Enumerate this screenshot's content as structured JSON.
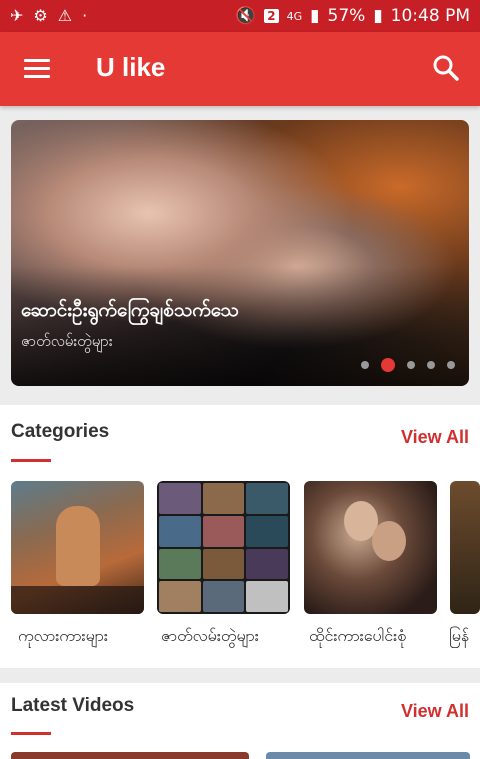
{
  "status_bar": {
    "battery": "57%",
    "time": "10:48 PM",
    "network": "4G",
    "sim": "2"
  },
  "app_bar": {
    "title": "U like"
  },
  "banner": {
    "title": "ဆောင်းဦးရွက်ကြွေချစ်သက်သေ",
    "subtitle": "ဇာတ်လမ်းတွဲများ",
    "slide_count": 5,
    "active_slide": 2
  },
  "categories": {
    "title": "Categories",
    "view_all": "View All",
    "items": [
      {
        "label": "ကုလားကားများ"
      },
      {
        "label": "ဇာတ်လမ်းတွဲများ"
      },
      {
        "label": "ထိုင်းကားပေါင်းစုံ"
      },
      {
        "label": "မြန်"
      }
    ]
  },
  "latest": {
    "title": "Latest Videos",
    "view_all": "View All"
  },
  "colors": {
    "accent": "#e53935",
    "status_bar": "#c61f26"
  }
}
